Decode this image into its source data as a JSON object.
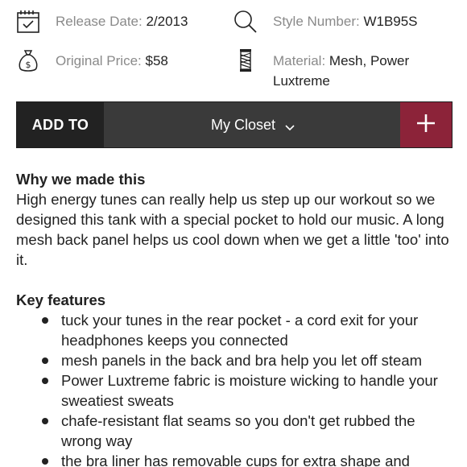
{
  "details": {
    "release_label": "Release Date:",
    "release_value": "2/2013",
    "style_label": "Style Number:",
    "style_value": "W1B95S",
    "price_label": "Original Price:",
    "price_value": "$58",
    "material_label": "Material:",
    "material_value_line1": "Mesh, Power",
    "material_value_line2": "Luxtreme",
    "icons": [
      "calendar-icon",
      "search-icon",
      "money-bag-icon",
      "thread-spool-icon"
    ]
  },
  "add_bar": {
    "add_label": "ADD TO",
    "closet_value": "My Closet",
    "plus_symbol": "+",
    "colors": {
      "label_bg": "#222222",
      "select_bg": "#3a3a3a",
      "plus_bg": "#8c2339"
    }
  },
  "why": {
    "heading": "Why we made this",
    "body": "High energy tunes can really help us step up our workout so we designed this tank with a special pocket to hold our music. A long mesh back panel helps us cool down when we get a little 'too' into it."
  },
  "features": {
    "heading": "Key features",
    "items": [
      "tuck your tunes in the rear pocket - a cord exit for your headphones keeps you connected",
      "mesh panels in the back and bra help you let off steam",
      "Power Luxtreme fabric is moisture wicking to handle your sweatiest sweats",
      "chafe-resistant flat seams so you don't get rubbed the wrong way",
      "the bra liner has removable cups for extra shape and"
    ]
  }
}
